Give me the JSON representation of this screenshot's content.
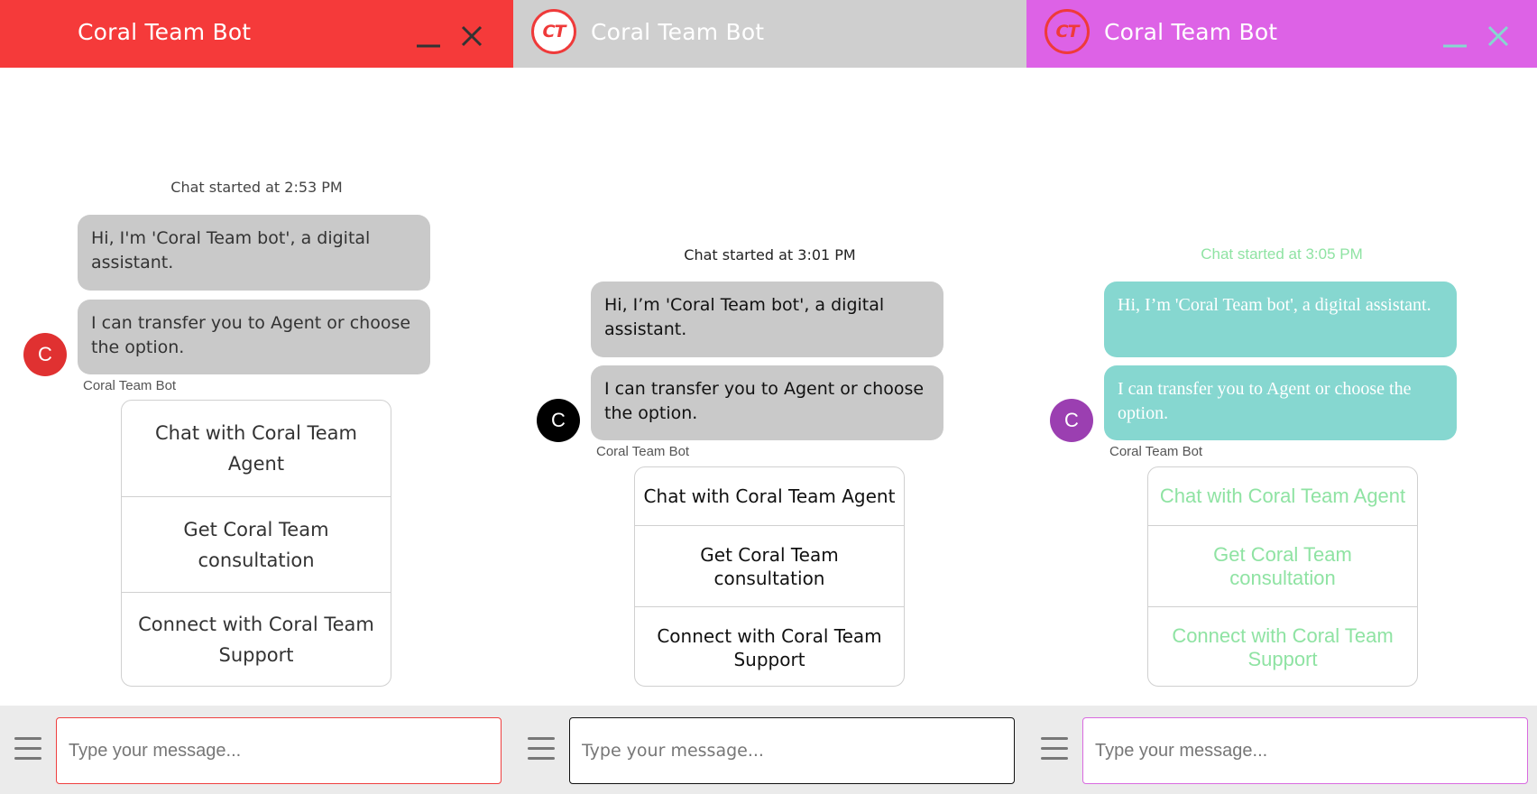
{
  "colors": {
    "red": "#f53a3a",
    "grey": "#cfcfcf",
    "magenta": "#dd62e6",
    "teal": "#86d7d0",
    "mint": "#8fe3a3",
    "purple": "#9b3fb1"
  },
  "panels": [
    {
      "title": "Coral Team Bot",
      "chat_started": "Chat started at 2:53 PM",
      "messages": [
        "Hi, I'm 'Coral Team bot', a digital assistant.",
        "I can transfer you to Agent or choose the option."
      ],
      "avatar_letter": "C",
      "bot_label": "Coral Team Bot",
      "options": [
        "Chat with Coral Team Agent",
        "Get Coral Team consultation",
        "Connect with Coral Team Support"
      ],
      "input_placeholder": "Type your message..."
    },
    {
      "title": "Coral Team Bot",
      "logo_text": "CT",
      "chat_started": "Chat started at 3:01 PM",
      "messages": [
        "Hi, I’m 'Coral Team bot', a digital assistant.",
        "I can transfer you to Agent or choose the option."
      ],
      "avatar_letter": "C",
      "bot_label": "Coral Team Bot",
      "options": [
        "Chat with Coral Team Agent",
        "Get Coral Team consultation",
        "Connect with Coral Team Support"
      ],
      "input_placeholder": "Type your message..."
    },
    {
      "title": "Coral Team Bot",
      "logo_text": "CT",
      "chat_started": "Chat started at 3:05 PM",
      "messages": [
        "Hi, I’m 'Coral Team bot', a digital assistant.",
        "I can transfer you to Agent or choose the option."
      ],
      "avatar_letter": "C",
      "bot_label": "Coral Team Bot",
      "options": [
        "Chat with Coral Team Agent",
        "Get Coral Team consultation",
        "Connect with Coral Team Support"
      ],
      "input_placeholder": "Type your message..."
    }
  ]
}
